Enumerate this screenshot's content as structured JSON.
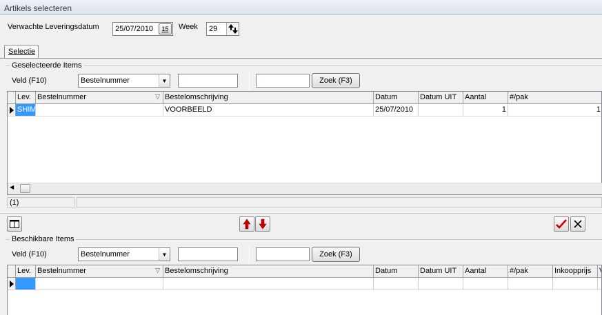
{
  "window": {
    "title": "Artikels selecteren"
  },
  "header": {
    "delivery_label": "Verwachte Leveringsdatum",
    "delivery_value": "25/07/2010",
    "calendar_glyph": "15",
    "week_label": "Week",
    "week_value": "29"
  },
  "tabs": [
    {
      "label": "Selectie"
    }
  ],
  "selected": {
    "group_label": "Geselecteerde Items",
    "field_label": "Veld (F10)",
    "field_select": "Bestelnummer",
    "search_value": "",
    "search2_value": "",
    "search_button": "Zoek (F3)",
    "columns": [
      "Lev.",
      "Bestelnummer",
      "Bestelomschrijving",
      "Datum",
      "Datum UIT",
      "Aantal",
      "#/pak"
    ],
    "rows": [
      {
        "lev": "SHIM",
        "bestelnummer": "",
        "omschrijving": "VOORBEELD",
        "datum": "25/07/2010",
        "datum_uit": "",
        "aantal": "1",
        "pak": "1"
      }
    ],
    "status_count": "(1)",
    "status_right": ""
  },
  "available": {
    "group_label": "Beschikbare Items",
    "field_label": "Veld (F10)",
    "field_select": "Bestelnummer",
    "search_value": "",
    "search2_value": "",
    "search_button": "Zoek (F3)",
    "columns": [
      "Lev.",
      "Bestelnummer",
      "Bestelomschrijving",
      "Datum",
      "Datum UIT",
      "Aantal",
      "#/pak",
      "Inkoopprijs",
      "V"
    ],
    "rows": [
      {
        "lev": "",
        "bestelnummer": "",
        "omschrijving": "",
        "datum": "",
        "datum_uit": "",
        "aantal": "",
        "pak": "",
        "inkoop": "",
        "v": ""
      }
    ]
  },
  "toolbar": {
    "columns_icon": "columns-icon",
    "move_up_icon": "red-arrow-up-icon",
    "move_down_icon": "red-arrow-down-icon",
    "confirm_icon": "red-checkmark-icon",
    "cancel_icon": "cross-icon"
  },
  "colors": {
    "selection": "#3399ff",
    "arrows": "#cc0000",
    "check": "#cc0000"
  }
}
